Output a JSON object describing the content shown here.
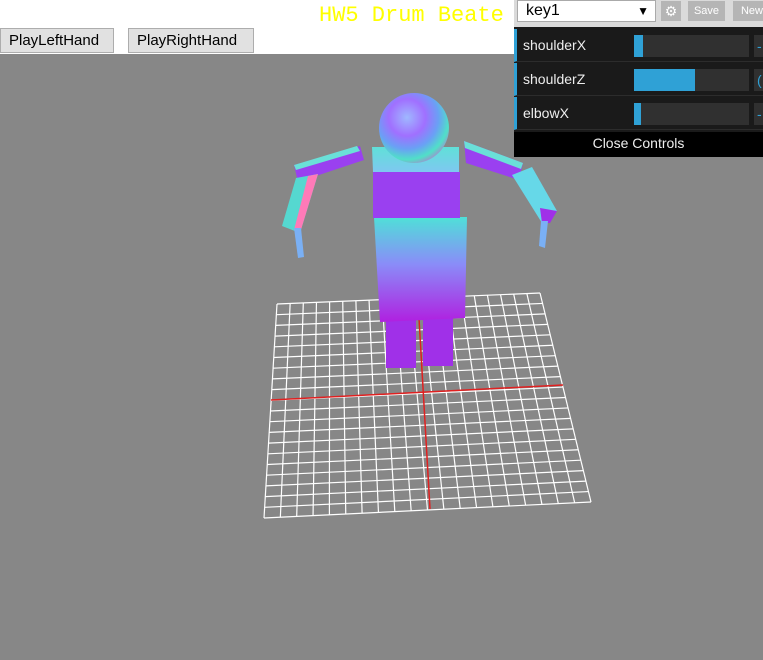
{
  "header": {
    "title": "HW5 Drum Beate",
    "play_left_label": "PlayLeftHand",
    "play_right_label": "PlayRightHand"
  },
  "gui": {
    "preset_value": "key1",
    "preset_arrow": "▼",
    "gear_icon": "⚙",
    "save_label": "Save",
    "new_label": "New",
    "controls": [
      {
        "label": "shoulderX",
        "fraction": 0.08,
        "input_text": "-"
      },
      {
        "label": "shoulderZ",
        "fraction": 0.53,
        "input_text": "("
      },
      {
        "label": "elbowX",
        "fraction": 0.06,
        "input_text": "-"
      }
    ],
    "close_label": "Close Controls",
    "accent_color": "#2fa1d6"
  },
  "scene": {
    "background_color": "#878787",
    "grid_color": "#ffffff",
    "axis_color": "#e02020"
  }
}
